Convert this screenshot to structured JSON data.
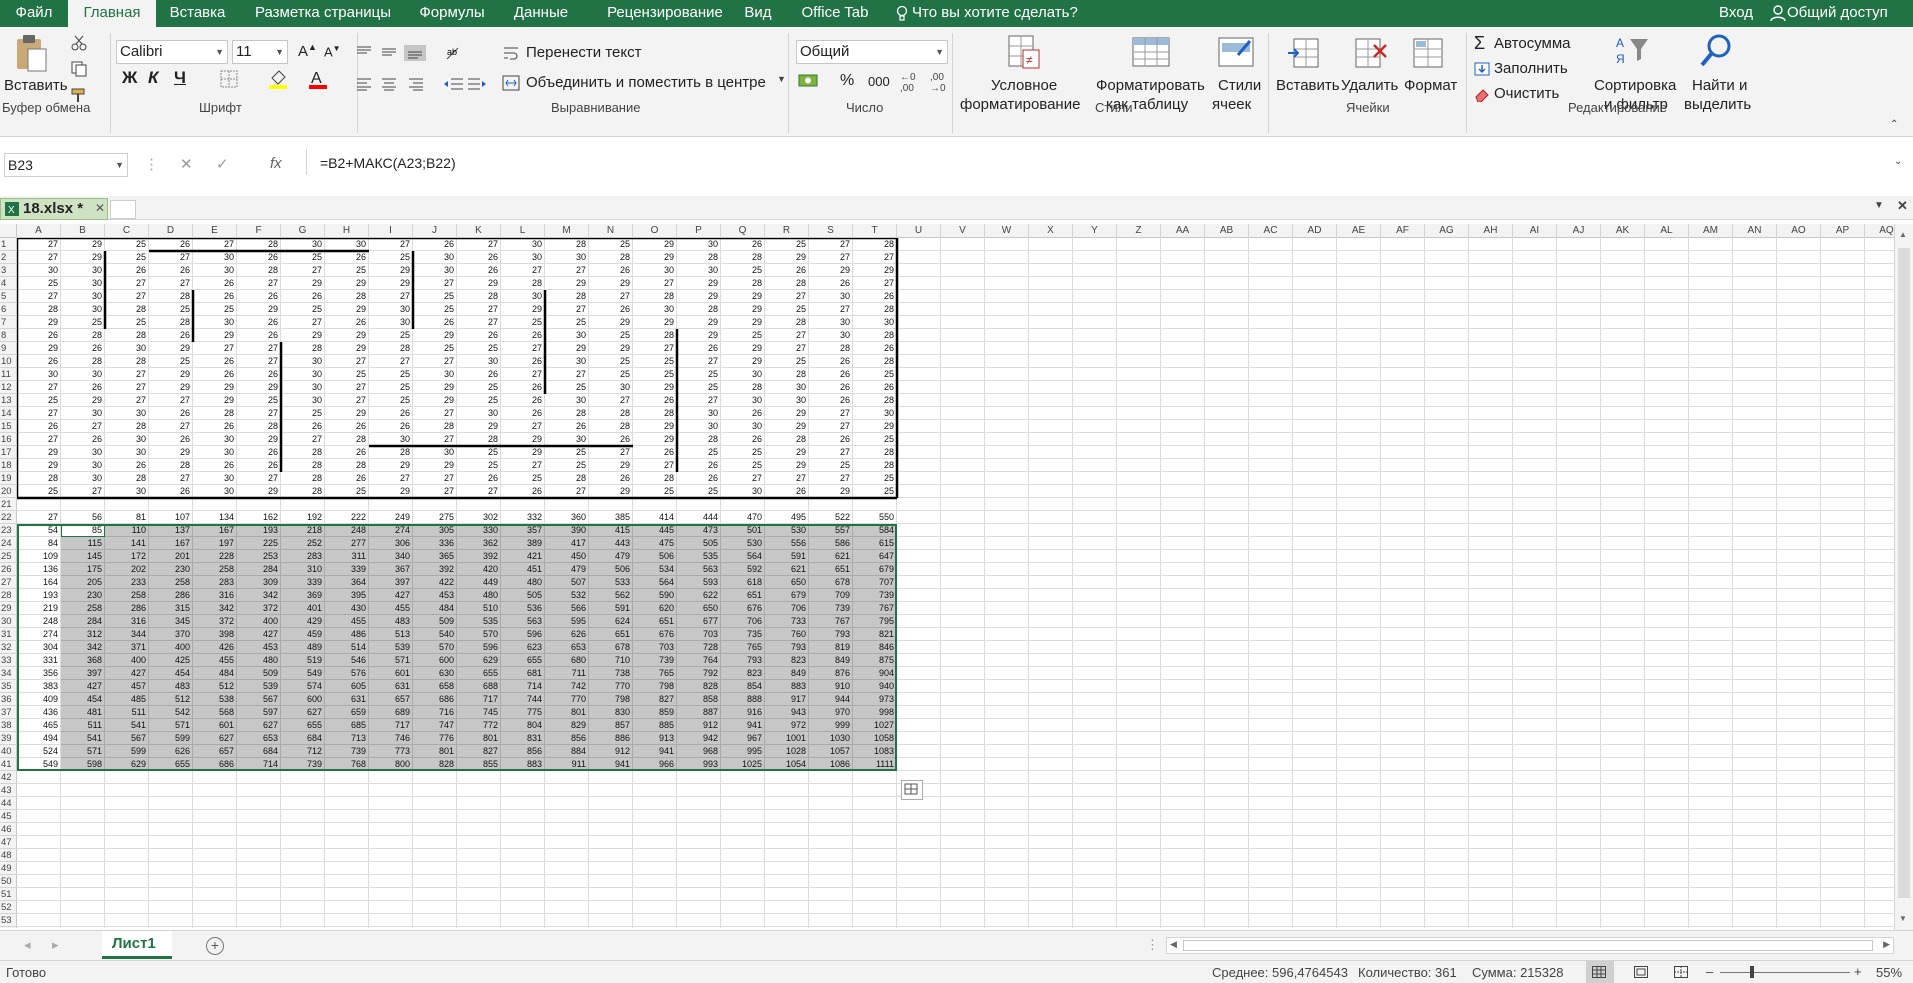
{
  "menu": {
    "items": [
      "Файл",
      "Главная",
      "Вставка",
      "Разметка страницы",
      "Формулы",
      "Данные",
      "Рецензирование",
      "Вид",
      "Office Tab"
    ],
    "tell_me": "Что вы хотите сделать?",
    "signin": "Вход",
    "share": "Общий доступ"
  },
  "ribbon": {
    "clipboard": {
      "paste": "Вставить",
      "group": "Буфер обмена"
    },
    "font": {
      "name": "Calibri",
      "size": "11",
      "bold": "Ж",
      "italic": "К",
      "underline": "Ч",
      "group": "Шрифт"
    },
    "alignment": {
      "wrap": "Перенести текст",
      "merge": "Объединить и поместить в центре",
      "group": "Выравнивание"
    },
    "number": {
      "format": "Общий",
      "group": "Число"
    },
    "styles": {
      "conditional_1": "Условное",
      "conditional_2": "форматирование",
      "table_1": "Форматировать",
      "table_2": "как таблицу",
      "cell_1": "Стили",
      "cell_2": "ячеек",
      "group": "Стили"
    },
    "cells": {
      "insert": "Вставить",
      "delete": "Удалить",
      "format": "Формат",
      "group": "Ячейки"
    },
    "editing": {
      "autosum": "Автосумма",
      "fill": "Заполнить",
      "clear": "Очистить",
      "sort_1": "Сортировка",
      "sort_2": "и фильтр",
      "find_1": "Найти и",
      "find_2": "выделить",
      "group": "Редактирование"
    }
  },
  "formula_bar": {
    "name_box": "B23",
    "formula": "=B2+МАКС(A23;B22)"
  },
  "doc_tab": {
    "name": "18.xlsx *"
  },
  "columns": [
    "A",
    "B",
    "C",
    "D",
    "E",
    "F",
    "G",
    "H",
    "I",
    "J",
    "K",
    "L",
    "M",
    "N",
    "O",
    "P",
    "Q",
    "R",
    "S",
    "T",
    "U",
    "V",
    "W",
    "X",
    "Y",
    "Z",
    "AA",
    "AB",
    "AC",
    "AD",
    "AE",
    "AF",
    "AG",
    "AH",
    "AI",
    "AJ",
    "AK",
    "AL",
    "AM",
    "AN",
    "AO",
    "AP",
    "AQ"
  ],
  "data_rows": [
    [
      27,
      29,
      25,
      26,
      27,
      28,
      30,
      30,
      27,
      26,
      27,
      30,
      28,
      25,
      29,
      30,
      26,
      25,
      27,
      28
    ],
    [
      27,
      29,
      25,
      27,
      30,
      26,
      25,
      26,
      25,
      30,
      26,
      30,
      30,
      28,
      29,
      28,
      28,
      29,
      27,
      27
    ],
    [
      30,
      30,
      26,
      26,
      30,
      28,
      27,
      25,
      29,
      30,
      26,
      27,
      27,
      26,
      30,
      30,
      25,
      26,
      29,
      29
    ],
    [
      25,
      30,
      27,
      27,
      26,
      27,
      29,
      29,
      29,
      27,
      29,
      28,
      29,
      29,
      27,
      29,
      28,
      28,
      26,
      27
    ],
    [
      27,
      30,
      27,
      28,
      26,
      26,
      26,
      28,
      27,
      25,
      28,
      30,
      28,
      27,
      28,
      29,
      29,
      27,
      30,
      26
    ],
    [
      28,
      30,
      28,
      25,
      25,
      29,
      25,
      29,
      30,
      25,
      27,
      29,
      27,
      26,
      30,
      28,
      29,
      25,
      27,
      28
    ],
    [
      29,
      25,
      25,
      28,
      30,
      26,
      27,
      26,
      30,
      26,
      27,
      25,
      25,
      29,
      29,
      29,
      29,
      28,
      30,
      30
    ],
    [
      26,
      28,
      28,
      26,
      29,
      26,
      29,
      29,
      25,
      29,
      26,
      26,
      30,
      25,
      28,
      29,
      25,
      27,
      30,
      28
    ],
    [
      29,
      26,
      30,
      29,
      27,
      27,
      28,
      29,
      28,
      25,
      25,
      27,
      29,
      29,
      27,
      26,
      29,
      27,
      28,
      26
    ],
    [
      26,
      28,
      28,
      25,
      26,
      27,
      30,
      27,
      27,
      27,
      30,
      26,
      30,
      25,
      25,
      27,
      29,
      25,
      26,
      28
    ],
    [
      30,
      30,
      27,
      29,
      26,
      26,
      30,
      25,
      25,
      30,
      26,
      27,
      27,
      25,
      25,
      25,
      30,
      28,
      26,
      25
    ],
    [
      27,
      26,
      27,
      29,
      29,
      29,
      30,
      27,
      25,
      29,
      25,
      26,
      25,
      30,
      29,
      25,
      28,
      30,
      26,
      26
    ],
    [
      25,
      29,
      27,
      27,
      29,
      25,
      30,
      27,
      25,
      29,
      25,
      26,
      30,
      27,
      26,
      27,
      30,
      30,
      26,
      28
    ],
    [
      27,
      30,
      30,
      26,
      28,
      27,
      25,
      29,
      26,
      27,
      30,
      26,
      28,
      28,
      28,
      30,
      26,
      29,
      27,
      30
    ],
    [
      26,
      27,
      28,
      27,
      26,
      28,
      26,
      26,
      26,
      28,
      29,
      27,
      26,
      28,
      29,
      30,
      30,
      29,
      27,
      29
    ],
    [
      27,
      26,
      30,
      26,
      30,
      29,
      27,
      28,
      30,
      27,
      28,
      29,
      30,
      26,
      29,
      28,
      26,
      28,
      26,
      25
    ],
    [
      29,
      30,
      30,
      29,
      30,
      26,
      28,
      26,
      28,
      30,
      25,
      29,
      25,
      27,
      26,
      25,
      25,
      29,
      27,
      28
    ],
    [
      29,
      30,
      26,
      28,
      26,
      26,
      28,
      28,
      29,
      29,
      25,
      27,
      25,
      29,
      27,
      26,
      25,
      29,
      25,
      28
    ],
    [
      28,
      30,
      28,
      27,
      30,
      27,
      28,
      26,
      27,
      27,
      26,
      25,
      28,
      26,
      28,
      26,
      27,
      27,
      27,
      25
    ],
    [
      25,
      27,
      30,
      26,
      30,
      29,
      28,
      25,
      29,
      27,
      27,
      26,
      27,
      29,
      25,
      25,
      30,
      26,
      29,
      25
    ]
  ],
  "row22": [
    27,
    56,
    81,
    107,
    134,
    162,
    192,
    222,
    249,
    275,
    302,
    332,
    360,
    385,
    414,
    444,
    470,
    495,
    522,
    550
  ],
  "sum_rows": [
    [
      54,
      85,
      110,
      137,
      167,
      193,
      218,
      248,
      274,
      305,
      330,
      357,
      390,
      415,
      445,
      473,
      501,
      530,
      557,
      584
    ],
    [
      84,
      115,
      141,
      167,
      197,
      225,
      252,
      277,
      306,
      336,
      362,
      389,
      417,
      443,
      475,
      505,
      530,
      556,
      586,
      615
    ],
    [
      109,
      145,
      172,
      201,
      228,
      253,
      283,
      311,
      340,
      365,
      392,
      421,
      450,
      479,
      506,
      535,
      564,
      591,
      621,
      647
    ],
    [
      136,
      175,
      202,
      230,
      258,
      284,
      310,
      339,
      367,
      392,
      420,
      451,
      479,
      506,
      534,
      563,
      592,
      621,
      651,
      679
    ],
    [
      164,
      205,
      233,
      258,
      283,
      309,
      339,
      364,
      397,
      422,
      449,
      480,
      507,
      533,
      564,
      593,
      618,
      650,
      678,
      707
    ],
    [
      193,
      230,
      258,
      286,
      316,
      342,
      369,
      395,
      427,
      453,
      480,
      505,
      532,
      562,
      590,
      622,
      651,
      679,
      709,
      739
    ],
    [
      219,
      258,
      286,
      315,
      342,
      372,
      401,
      430,
      455,
      484,
      510,
      536,
      566,
      591,
      620,
      650,
      676,
      706,
      739,
      767
    ],
    [
      248,
      284,
      316,
      345,
      372,
      400,
      429,
      455,
      483,
      509,
      535,
      563,
      595,
      624,
      651,
      677,
      706,
      733,
      767,
      795
    ],
    [
      274,
      312,
      344,
      370,
      398,
      427,
      459,
      486,
      513,
      540,
      570,
      596,
      626,
      651,
      676,
      703,
      735,
      760,
      793,
      821
    ],
    [
      304,
      342,
      371,
      400,
      426,
      453,
      489,
      514,
      539,
      570,
      596,
      623,
      653,
      678,
      703,
      728,
      765,
      793,
      819,
      846
    ],
    [
      331,
      368,
      400,
      425,
      455,
      480,
      519,
      546,
      571,
      600,
      629,
      655,
      680,
      710,
      739,
      764,
      793,
      823,
      849,
      875
    ],
    [
      356,
      397,
      427,
      454,
      484,
      509,
      549,
      576,
      601,
      630,
      655,
      681,
      711,
      738,
      765,
      792,
      823,
      849,
      876,
      904
    ],
    [
      383,
      427,
      457,
      483,
      512,
      539,
      574,
      605,
      631,
      658,
      688,
      714,
      742,
      770,
      798,
      828,
      854,
      883,
      910,
      940
    ],
    [
      409,
      454,
      485,
      512,
      538,
      567,
      600,
      631,
      657,
      686,
      717,
      744,
      770,
      798,
      827,
      858,
      888,
      917,
      944,
      973
    ],
    [
      436,
      481,
      511,
      542,
      568,
      597,
      627,
      659,
      689,
      716,
      745,
      775,
      801,
      830,
      859,
      887,
      916,
      943,
      970,
      998
    ],
    [
      465,
      511,
      541,
      571,
      601,
      627,
      655,
      685,
      717,
      747,
      772,
      804,
      829,
      857,
      885,
      912,
      941,
      972,
      999,
      1027
    ],
    [
      494,
      541,
      567,
      599,
      627,
      653,
      684,
      713,
      746,
      776,
      801,
      831,
      856,
      886,
      913,
      942,
      967,
      1001,
      1030,
      1058
    ],
    [
      524,
      571,
      599,
      626,
      657,
      684,
      712,
      739,
      773,
      801,
      827,
      856,
      884,
      912,
      941,
      968,
      995,
      1028,
      1057,
      1083
    ],
    [
      549,
      598,
      629,
      655,
      686,
      714,
      739,
      768,
      800,
      828,
      855,
      883,
      911,
      941,
      966,
      993,
      1025,
      1054,
      1086,
      1111
    ]
  ],
  "sheet": {
    "name": "Лист1"
  },
  "status": {
    "ready": "Готово",
    "average": "Среднее: 596,4764543",
    "count": "Количество: 361",
    "sum": "Сумма: 215328",
    "zoom": "55%"
  }
}
